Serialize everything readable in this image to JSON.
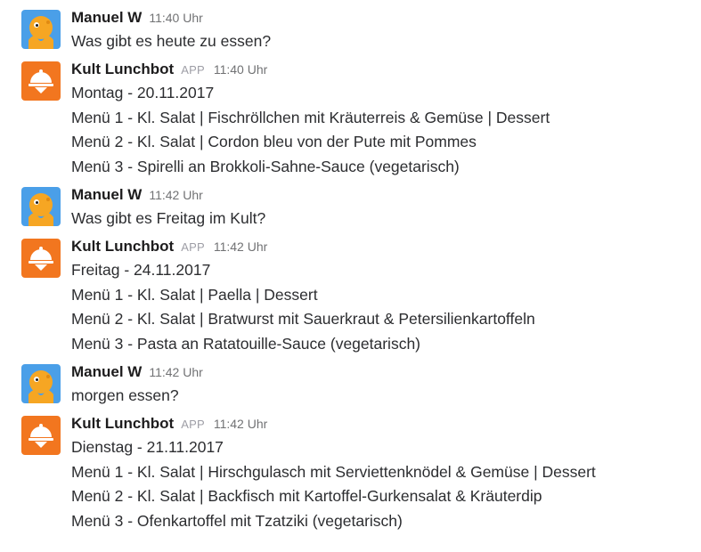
{
  "messages": [
    {
      "author": "Manuel W",
      "time": "11:40 Uhr",
      "lines": [
        "Was gibt es heute zu essen?"
      ]
    },
    {
      "author": "Kult Lunchbot",
      "badge": "APP",
      "time": "11:40 Uhr",
      "lines": [
        "Montag - 20.11.2017",
        "Menü 1 - Kl. Salat | Fischröllchen mit Kräuterreis & Gemüse | Dessert",
        "Menü 2 - Kl. Salat | Cordon bleu von der Pute mit Pommes",
        "Menü 3 - Spirelli an Brokkoli-Sahne-Sauce (vegetarisch)"
      ]
    },
    {
      "author": "Manuel W",
      "time": "11:42 Uhr",
      "lines": [
        "Was gibt es Freitag im Kult?"
      ]
    },
    {
      "author": "Kult Lunchbot",
      "badge": "APP",
      "time": "11:42 Uhr",
      "lines": [
        "Freitag - 24.11.2017",
        "Menü 1 - Kl. Salat | Paella | Dessert",
        "Menü 2 - Kl. Salat | Bratwurst mit Sauerkraut & Petersilienkartoffeln",
        "Menü 3 - Pasta an Ratatouille-Sauce (vegetarisch)"
      ]
    },
    {
      "author": "Manuel W",
      "time": "11:42 Uhr",
      "lines": [
        "morgen essen?"
      ]
    },
    {
      "author": "Kult Lunchbot",
      "badge": "APP",
      "time": "11:42 Uhr",
      "lines": [
        "Dienstag - 21.11.2017",
        "Menü 1 - Kl. Salat | Hirschgulasch mit Serviettenknödel & Gemüse | Dessert",
        "Menü 2 - Kl. Salat | Backfisch mit Kartoffel-Gurkensalat & Kräuterdip",
        "Menü 3 - Ofenkartoffel mit Tzatziki (vegetarisch)"
      ]
    }
  ],
  "colors": {
    "bot_avatar_bg": "#f2761f",
    "user_avatar_bg": "#4a9fe8",
    "user_avatar_figure": "#f6a623"
  },
  "icons": {
    "user_avatar": "octopus-avatar-icon",
    "bot_avatar": "cloche-serving-icon"
  }
}
